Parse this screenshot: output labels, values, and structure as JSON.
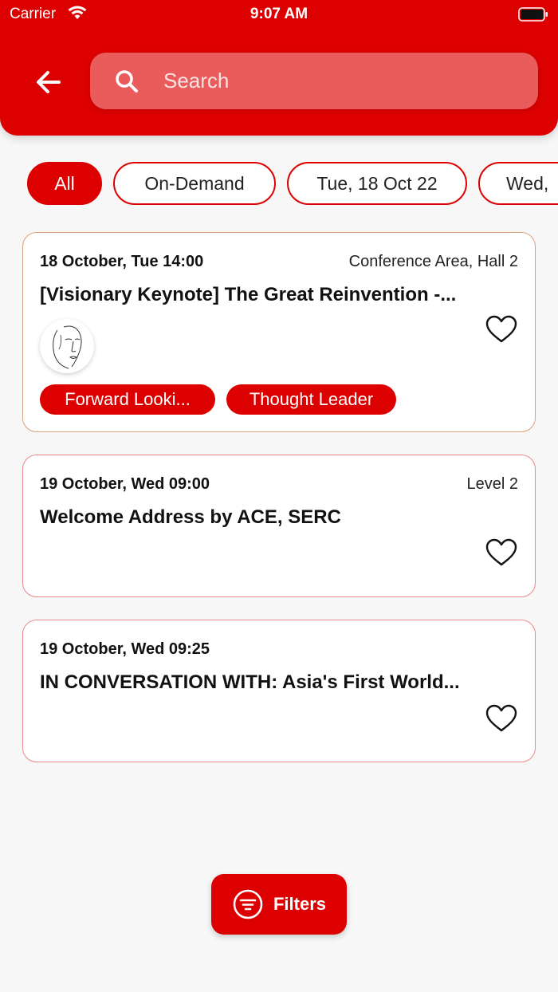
{
  "status_bar": {
    "carrier": "Carrier",
    "time": "9:07 AM"
  },
  "search": {
    "placeholder": "Search"
  },
  "chips": [
    "All",
    "On-Demand",
    "Tue, 18 Oct 22",
    "Wed,"
  ],
  "sessions": [
    {
      "date": "18 October, Tue 14:00",
      "location": "Conference Area, Hall 2",
      "title": "[Visionary Keynote] The Great Reinvention -...",
      "tags": [
        "Forward Looki...",
        "Thought Leader"
      ]
    },
    {
      "date": "19 October, Wed 09:00",
      "location": "Level 2",
      "title": "Welcome Address by ACE, SERC"
    },
    {
      "date": "19 October, Wed 09:25",
      "location": "",
      "title": "IN CONVERSATION WITH: Asia's First World..."
    }
  ],
  "filters_button": {
    "label": "Filters"
  },
  "colors": {
    "primary": "#dc0000",
    "search_bg": "#ea5c5c",
    "card_border": "#e88a8a"
  }
}
